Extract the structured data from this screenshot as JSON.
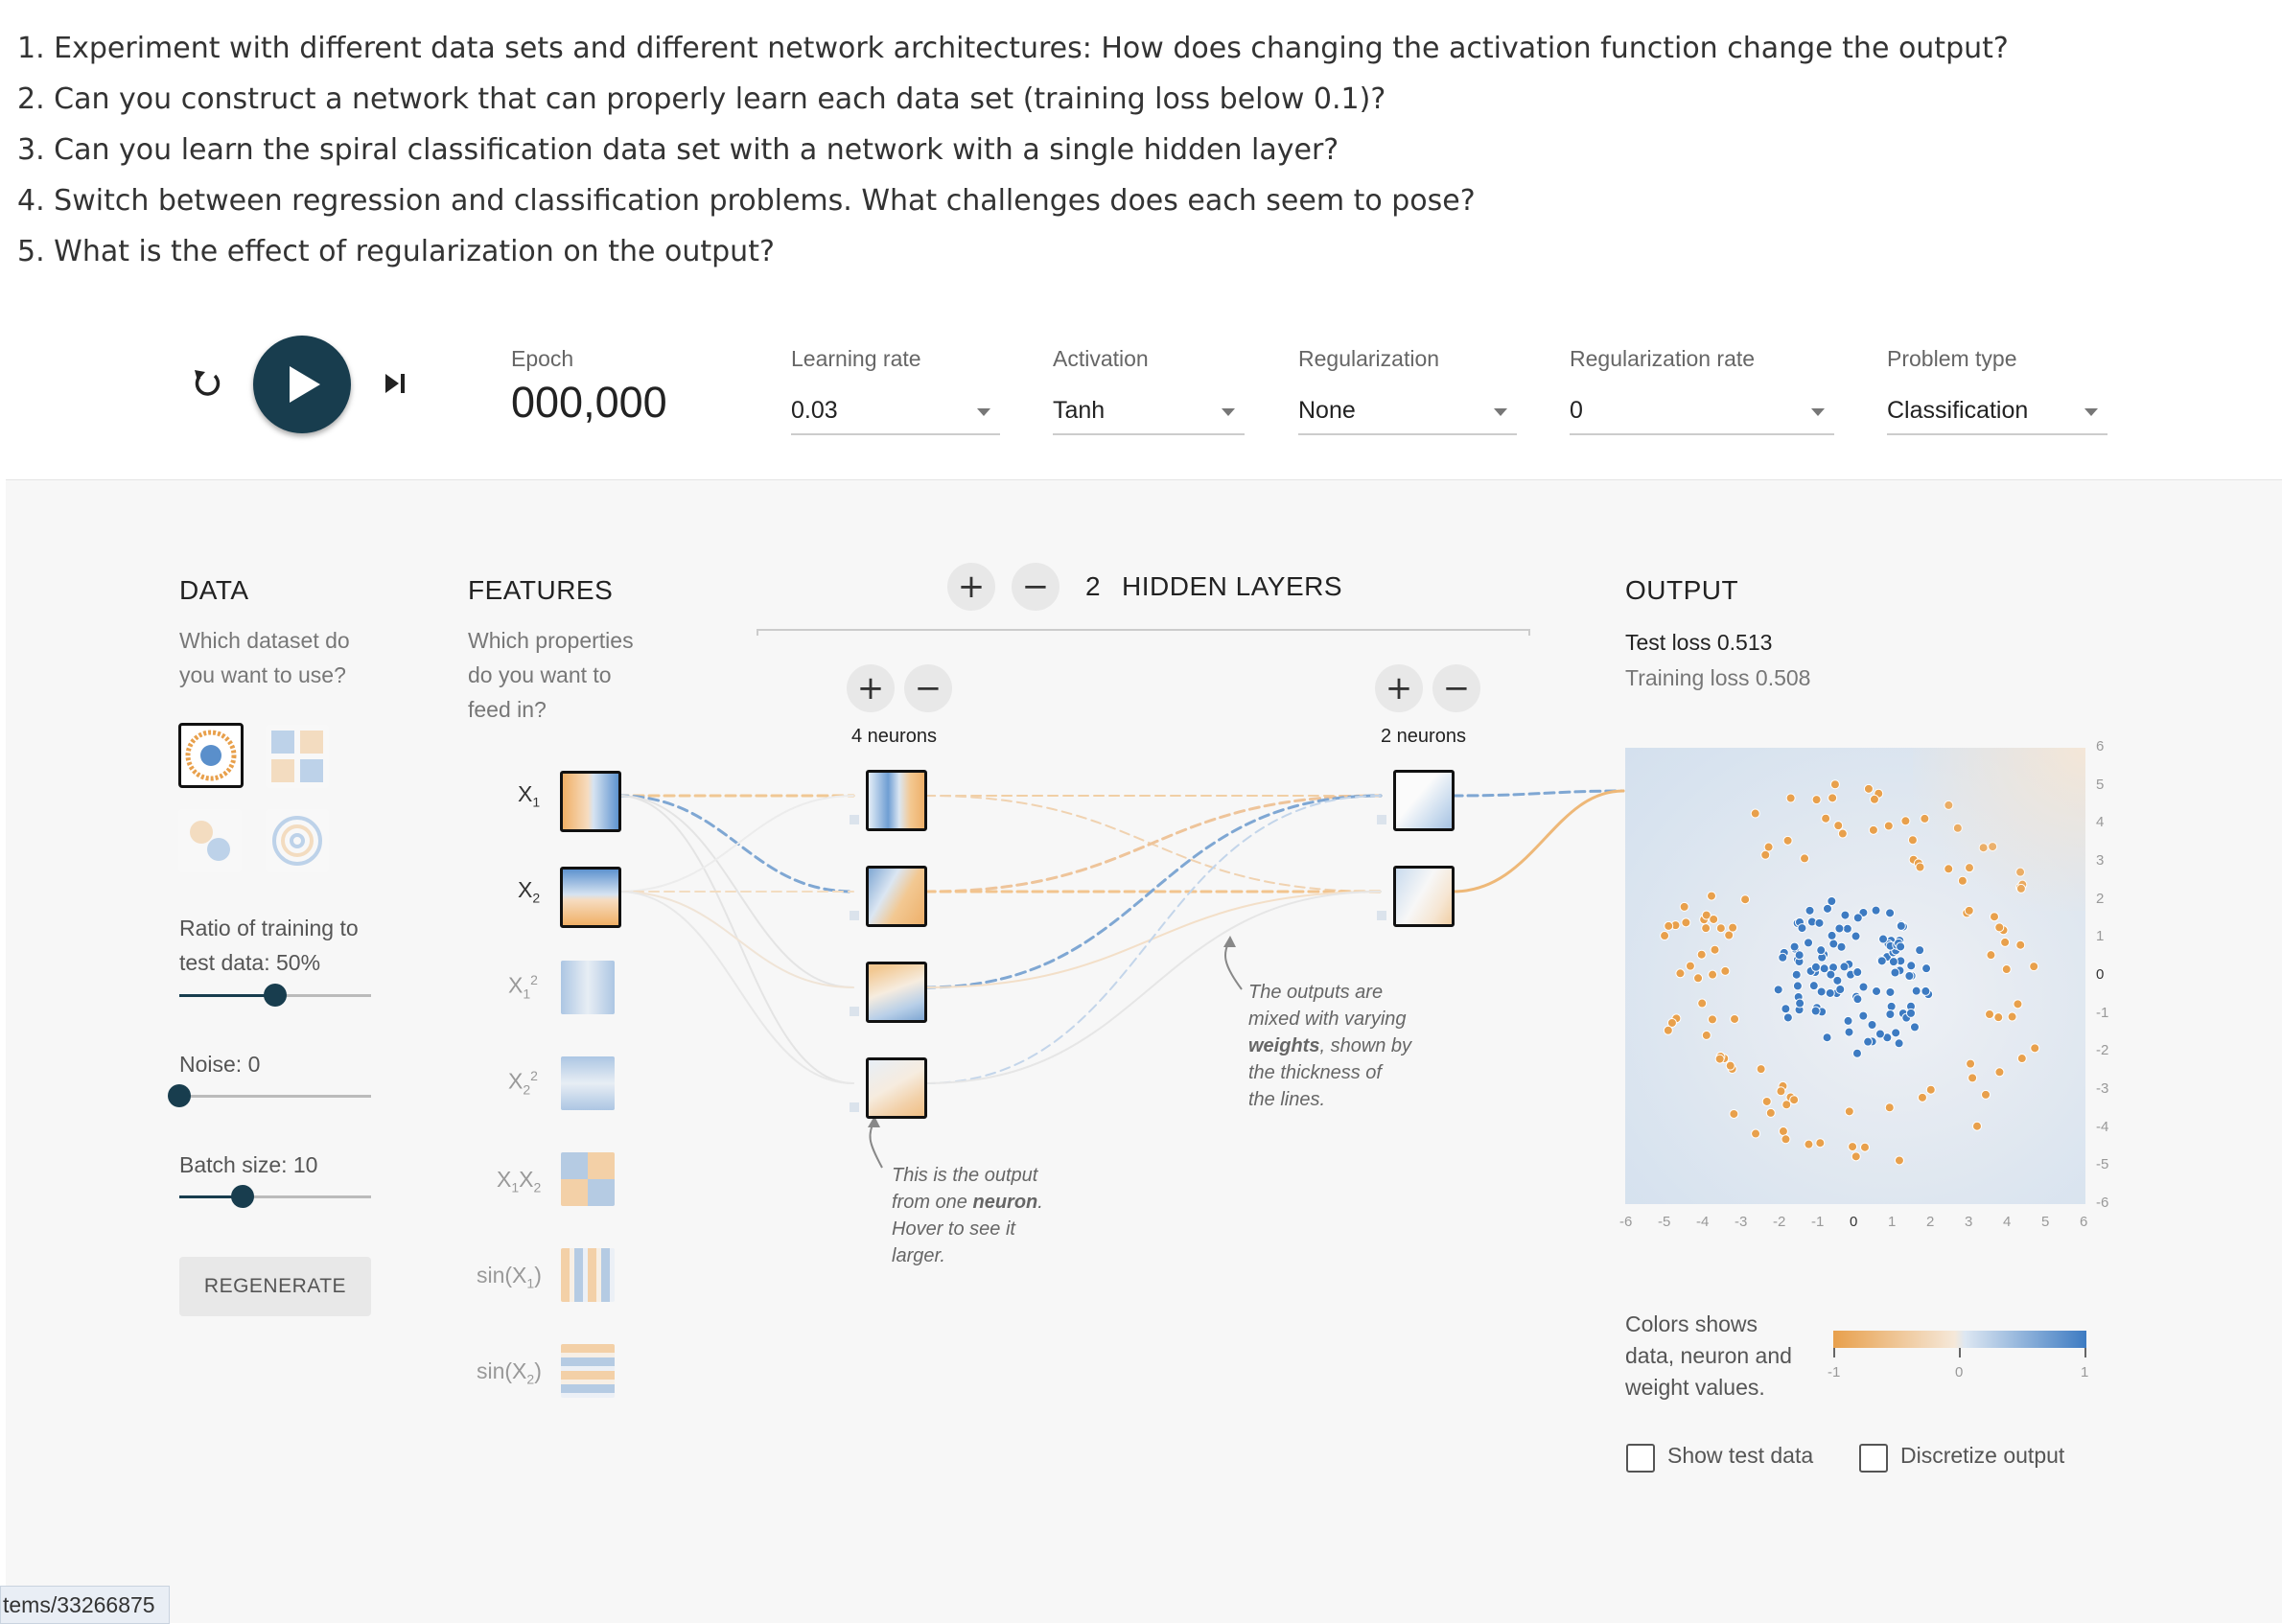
{
  "questions": [
    "1. Experiment with different data sets and different network architectures: How does changing the activation function change the output?",
    "2. Can you construct a network that can properly learn each data set (training loss below 0.1)?",
    "3. Can you learn the spiral classification data set with a network with a single hidden layer?",
    "4. Switch between regression and classification problems. What challenges does each seem to pose?",
    "5. What is the effect of regularization on the output?"
  ],
  "controls": {
    "epoch_label": "Epoch",
    "epoch_value": "000,000",
    "learning_rate": {
      "label": "Learning rate",
      "value": "0.03"
    },
    "activation": {
      "label": "Activation",
      "value": "Tanh"
    },
    "regularization": {
      "label": "Regularization",
      "value": "None"
    },
    "regularization_rate": {
      "label": "Regularization rate",
      "value": "0"
    },
    "problem_type": {
      "label": "Problem type",
      "value": "Classification"
    }
  },
  "data_panel": {
    "title": "DATA",
    "subtitle_1": "Which dataset do",
    "subtitle_2": "you want to use?",
    "ratio_label_1": "Ratio of training to",
    "ratio_label_2": "test data:  50%",
    "ratio_value": 0.5,
    "noise_label": "Noise:  0",
    "noise_value": 0,
    "batch_label": "Batch size:  10",
    "batch_value": 0.33,
    "regenerate": "REGENERATE"
  },
  "features_panel": {
    "title": "FEATURES",
    "subtitle_1": "Which properties",
    "subtitle_2": "do you want to",
    "subtitle_3": "feed in?",
    "x1": "X",
    "x1_sub": "1",
    "x2": "X",
    "x2_sub": "2",
    "x1sq": "X",
    "x1sq_sub": "1",
    "x1sq_sup": "2",
    "x2sq": "X",
    "x2sq_sub": "2",
    "x2sq_sup": "2",
    "x1x2_a": "X",
    "x1x2_sub_a": "1",
    "x1x2_b": "X",
    "x1x2_sub_b": "2",
    "sin1": "sin(X",
    "sin1_sub": "1",
    "sin1_end": ")",
    "sin2": "sin(X",
    "sin2_sub": "2",
    "sin2_end": ")"
  },
  "hidden": {
    "count": "2",
    "title": "HIDDEN LAYERS",
    "layer1_neurons": "4 neurons",
    "layer2_neurons": "2 neurons",
    "note1_a": "This is the output",
    "note1_b": "from one ",
    "note1_b_bold": "neuron",
    "note1_b_end": ".",
    "note1_c": "Hover to see it",
    "note1_d": "larger.",
    "note2_a": "The outputs are",
    "note2_b": "mixed with varying",
    "note2_c_bold": "weights",
    "note2_c": ", shown by",
    "note2_d": "the thickness of",
    "note2_e": "the lines."
  },
  "output": {
    "title": "OUTPUT",
    "test_loss": "Test loss 0.513",
    "training_loss": "Training loss 0.508",
    "axis_ticks": [
      "-6",
      "-5",
      "-4",
      "-3",
      "-2",
      "-1",
      "0",
      "1",
      "2",
      "3",
      "4",
      "5",
      "6"
    ],
    "colors_text_1": "Colors shows",
    "colors_text_2": "data, neuron and",
    "colors_text_3": "weight values.",
    "scale_min": "-1",
    "scale_mid": "0",
    "scale_max": "1",
    "show_test_data": "Show test data",
    "discretize_output": "Discretize output",
    "orange": "#e8a04c",
    "blue": "#3d7bc2"
  },
  "status_url": "tems/33266875"
}
